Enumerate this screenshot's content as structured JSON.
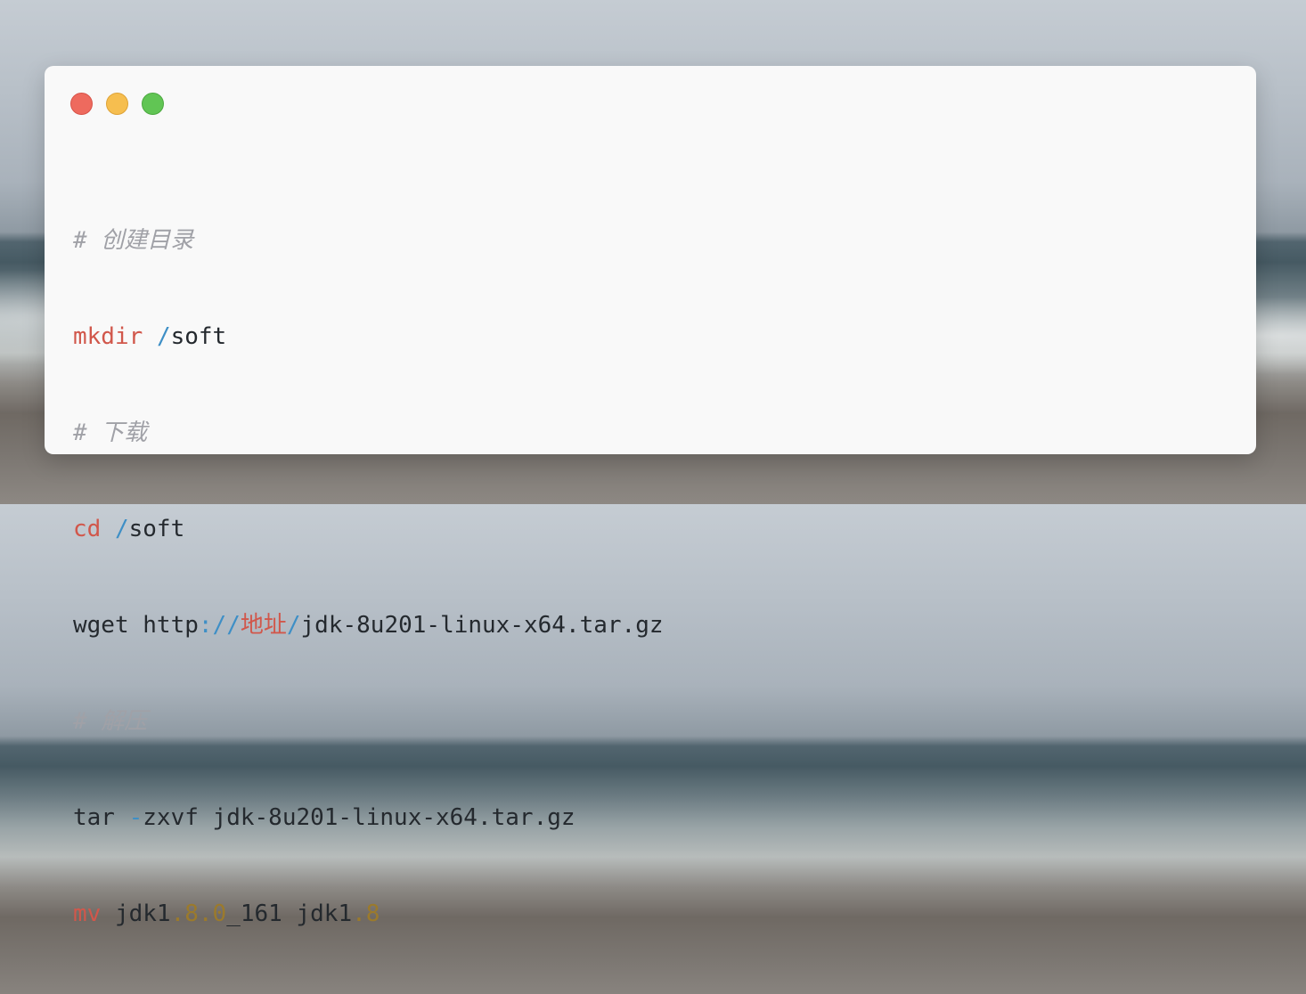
{
  "window": {
    "controls": {
      "close": "close-control",
      "minimize": "minimize-control",
      "zoom": "zoom-control"
    }
  },
  "code": {
    "lines": [
      {
        "comment": "# 创建目录"
      },
      {
        "cmd": "mkdir",
        "sp": " ",
        "slash": "/",
        "rest": "soft"
      },
      {
        "comment": "# 下载"
      },
      {
        "cmd": "cd",
        "sp": " ",
        "slash": "/",
        "rest": "soft"
      },
      {
        "cmd": "wget http",
        "sep": "://",
        "host": "地址",
        "slash": "/",
        "rest": "jdk-8u201-linux-x64.tar.gz"
      },
      {
        "comment": "# 解压"
      },
      {
        "cmd": "tar",
        "sp": " ",
        "flag": "-",
        "rest": "zxvf jdk-8u201-linux-x64.tar.gz"
      },
      {
        "cmd": "mv",
        "a": " jdk1",
        "b": ".8.0",
        "c": "_161 jdk1",
        "d": ".8"
      }
    ]
  },
  "colors": {
    "comment": "#a0a1a7",
    "keyword": "#d1574b",
    "operator": "#3e8fc6",
    "number": "#9b7a2c",
    "text": "#24292e",
    "window_bg": "#f9f9f9"
  }
}
